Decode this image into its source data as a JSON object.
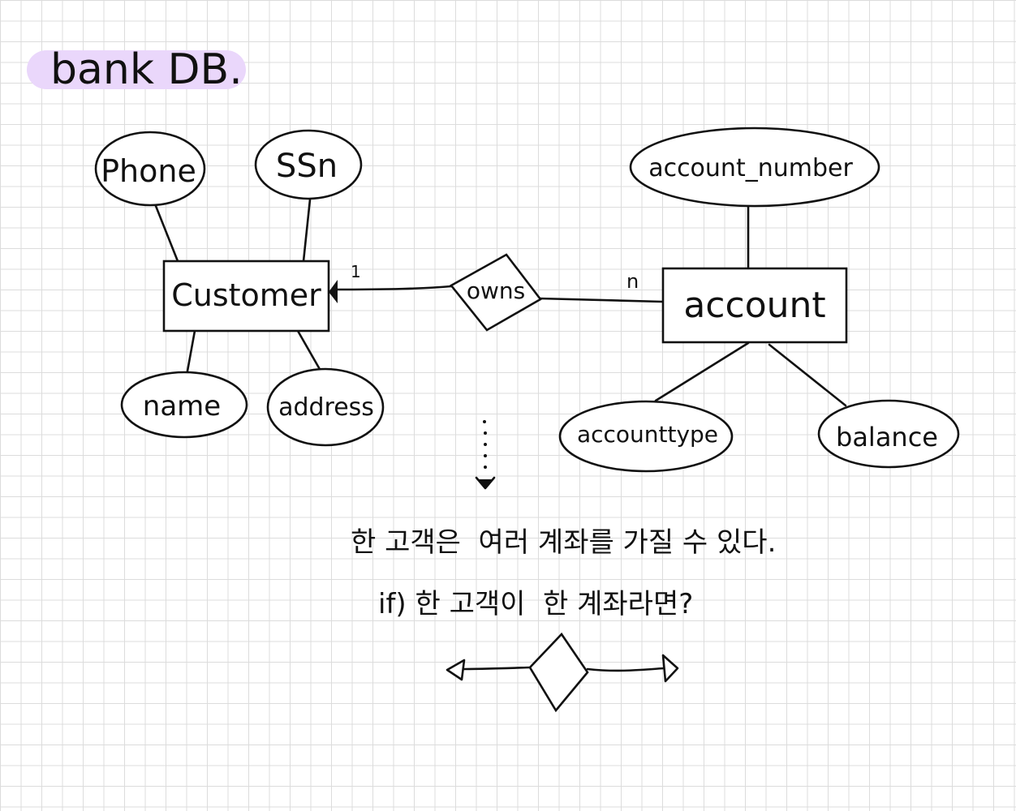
{
  "title": "bank DB.",
  "highlight_color": "#ead7fb",
  "entities": {
    "customer": "Customer",
    "account": "account"
  },
  "relationship": "owns",
  "attributes": {
    "phone": "Phone",
    "ssn": "SSn",
    "name": "name",
    "address": "address",
    "account_number": "account_number",
    "accounttype": "accounttype",
    "balance": "balance"
  },
  "cardinality": {
    "customer_side": "1",
    "account_side": "n"
  },
  "notes": {
    "line1": "한 고객은  여러 계좌를 가질 수 있다.",
    "line2": "if) 한 고객이  한 계좌라면?"
  }
}
